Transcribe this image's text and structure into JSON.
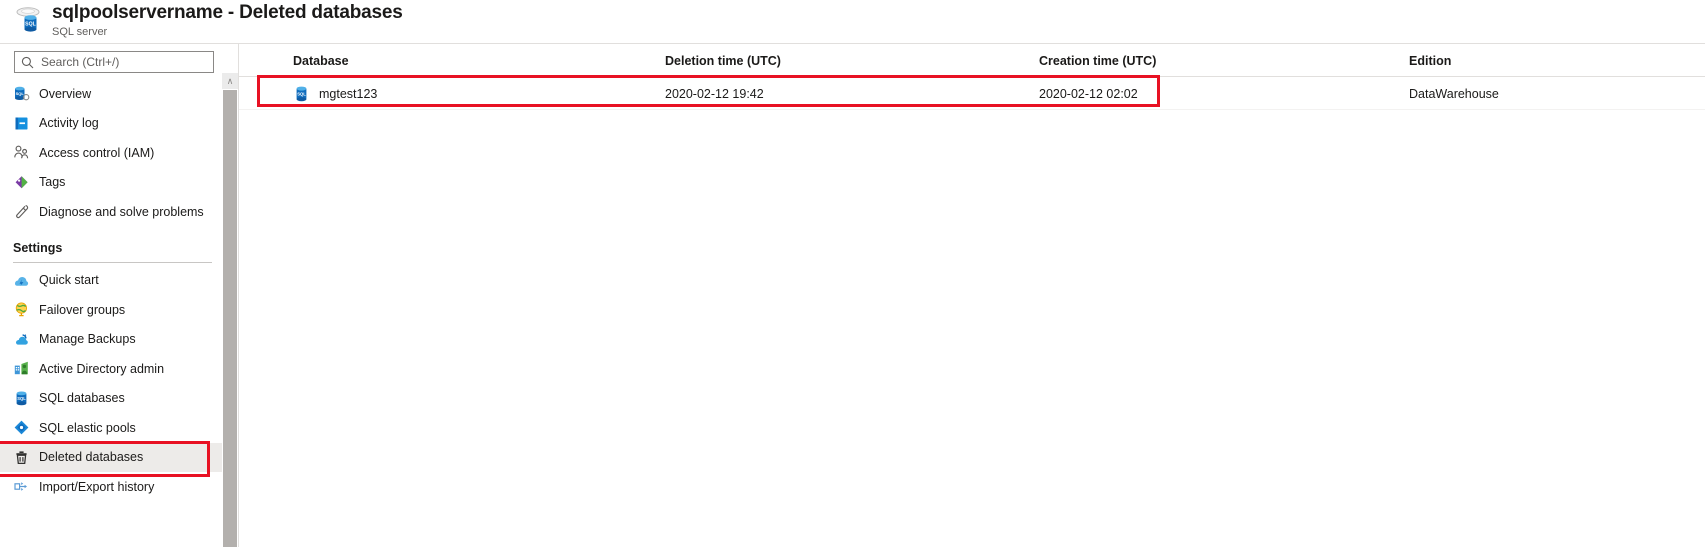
{
  "header": {
    "icon": "sql-server-icon",
    "title": "sqlpoolservername - Deleted databases",
    "subtitle": "SQL server"
  },
  "sidebar": {
    "search": {
      "icon": "search-icon",
      "placeholder": "Search (Ctrl+/)",
      "value": ""
    },
    "collapse": {
      "icon": "chevron-double-left-icon",
      "label": "«"
    },
    "scrollbar": {
      "up_icon": "chevron-up-icon",
      "up_label": "∧"
    },
    "items": [
      {
        "label": "Overview",
        "icon": "sql-server-icon",
        "type": "item"
      },
      {
        "label": "Activity log",
        "icon": "activity-log-icon",
        "type": "item"
      },
      {
        "label": "Access control (IAM)",
        "icon": "access-control-icon",
        "type": "item"
      },
      {
        "label": "Tags",
        "icon": "tags-icon",
        "type": "item"
      },
      {
        "label": "Diagnose and solve problems",
        "icon": "diagnose-icon",
        "type": "item"
      },
      {
        "label": "Settings",
        "icon": "",
        "type": "section"
      },
      {
        "label": "Quick start",
        "icon": "quick-start-icon",
        "type": "item"
      },
      {
        "label": "Failover groups",
        "icon": "failover-groups-icon",
        "type": "item"
      },
      {
        "label": "Manage Backups",
        "icon": "manage-backups-icon",
        "type": "item"
      },
      {
        "label": "Active Directory admin",
        "icon": "active-directory-icon",
        "type": "item"
      },
      {
        "label": "SQL databases",
        "icon": "sql-database-icon",
        "type": "item"
      },
      {
        "label": "SQL elastic pools",
        "icon": "sql-elastic-pools-icon",
        "type": "item"
      },
      {
        "label": "Deleted databases",
        "icon": "trash-icon",
        "type": "item",
        "selected": true,
        "highlighted": true
      },
      {
        "label": "Import/Export history",
        "icon": "import-export-icon",
        "type": "item"
      }
    ]
  },
  "grid": {
    "columns": [
      {
        "key": "database",
        "label": "Database"
      },
      {
        "key": "deletion_time",
        "label": "Deletion time (UTC)"
      },
      {
        "key": "creation_time",
        "label": "Creation time (UTC)"
      },
      {
        "key": "edition",
        "label": "Edition"
      }
    ],
    "rows": [
      {
        "database": "mgtest123",
        "database_icon": "sql-database-icon",
        "deletion_time": "2020-02-12 19:42",
        "creation_time": "2020-02-12 02:02",
        "edition": "DataWarehouse"
      }
    ]
  },
  "colors": {
    "highlight_red": "#e81123",
    "azure_blue": "#0078d4",
    "selected_bg": "#edebe9",
    "border": "#e1dfdd"
  }
}
